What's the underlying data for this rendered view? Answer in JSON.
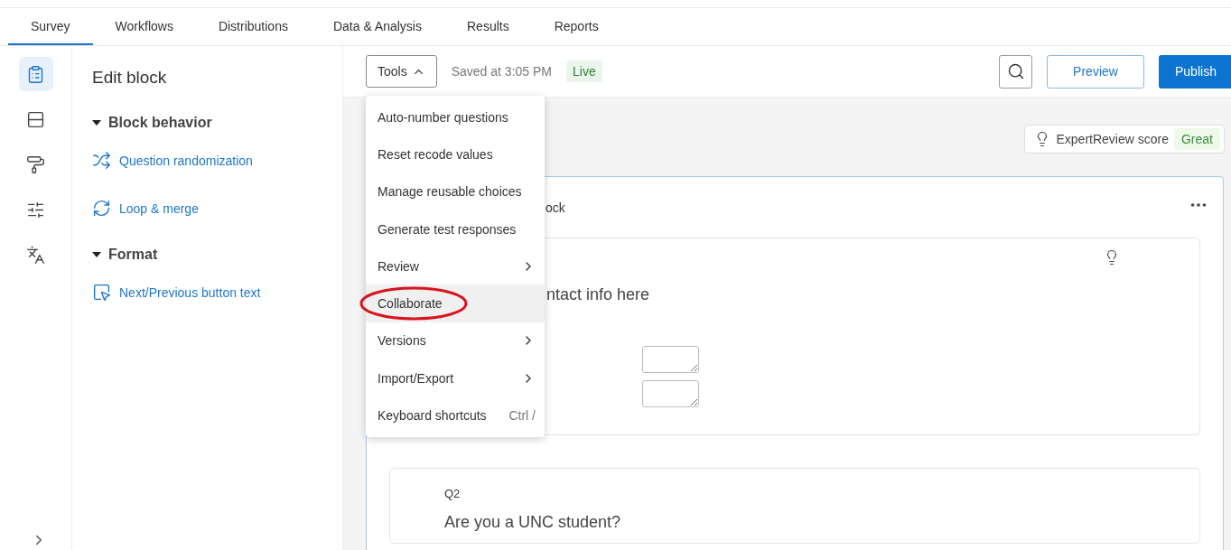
{
  "tabs": [
    {
      "label": "Survey",
      "selected": true
    },
    {
      "label": "Workflows",
      "selected": false
    },
    {
      "label": "Distributions",
      "selected": false
    },
    {
      "label": "Data & Analysis",
      "selected": false
    },
    {
      "label": "Results",
      "selected": false
    },
    {
      "label": "Reports",
      "selected": false
    }
  ],
  "rail": [
    {
      "kind": "survey",
      "selected": true
    },
    {
      "kind": "blocks",
      "selected": false
    },
    {
      "kind": "style",
      "selected": false
    },
    {
      "kind": "options",
      "selected": false
    },
    {
      "kind": "translate",
      "selected": false
    }
  ],
  "panel": {
    "title": "Edit block",
    "sections": [
      {
        "title": "Block behavior",
        "expanded": true,
        "items": [
          {
            "kind": "shuffle",
            "label": "Question randomization"
          },
          {
            "kind": "loop",
            "label": "Loop & merge"
          }
        ]
      },
      {
        "title": "Format",
        "expanded": true,
        "items": [
          {
            "kind": "pointer",
            "label": "Next/Previous button text"
          }
        ]
      }
    ]
  },
  "toolbar": {
    "tools": "Tools",
    "saved": "Saved at 3:05 PM",
    "status": "Live",
    "preview": "Preview",
    "publish": "Publish"
  },
  "tools_menu": [
    {
      "label": "Auto-number questions",
      "submenu": false,
      "highlighted": false,
      "circled": false
    },
    {
      "label": "Reset recode values",
      "submenu": false,
      "highlighted": false,
      "circled": false
    },
    {
      "label": "Manage reusable choices",
      "submenu": false,
      "highlighted": false,
      "circled": false
    },
    {
      "label": "Generate test responses",
      "submenu": false,
      "highlighted": false,
      "circled": false
    },
    {
      "label": "Review",
      "submenu": true,
      "highlighted": false,
      "circled": false
    },
    {
      "label": "Collaborate",
      "submenu": false,
      "highlighted": true,
      "circled": true
    },
    {
      "label": "Versions",
      "submenu": true,
      "highlighted": false,
      "circled": false
    },
    {
      "label": "Import/Export",
      "submenu": true,
      "highlighted": false,
      "circled": false
    },
    {
      "label": "Keyboard shortcuts",
      "shortcut": "Ctrl /",
      "submenu": false,
      "highlighted": false,
      "circled": false
    }
  ],
  "expert_review": {
    "label": "ExpertReview score",
    "score": "Great"
  },
  "block": {
    "title": "ock",
    "questions": [
      {
        "kind": "form",
        "text": "ntact info here"
      },
      {
        "kind": "question",
        "number": "Q2",
        "text": "Are you a UNC student?"
      }
    ]
  }
}
